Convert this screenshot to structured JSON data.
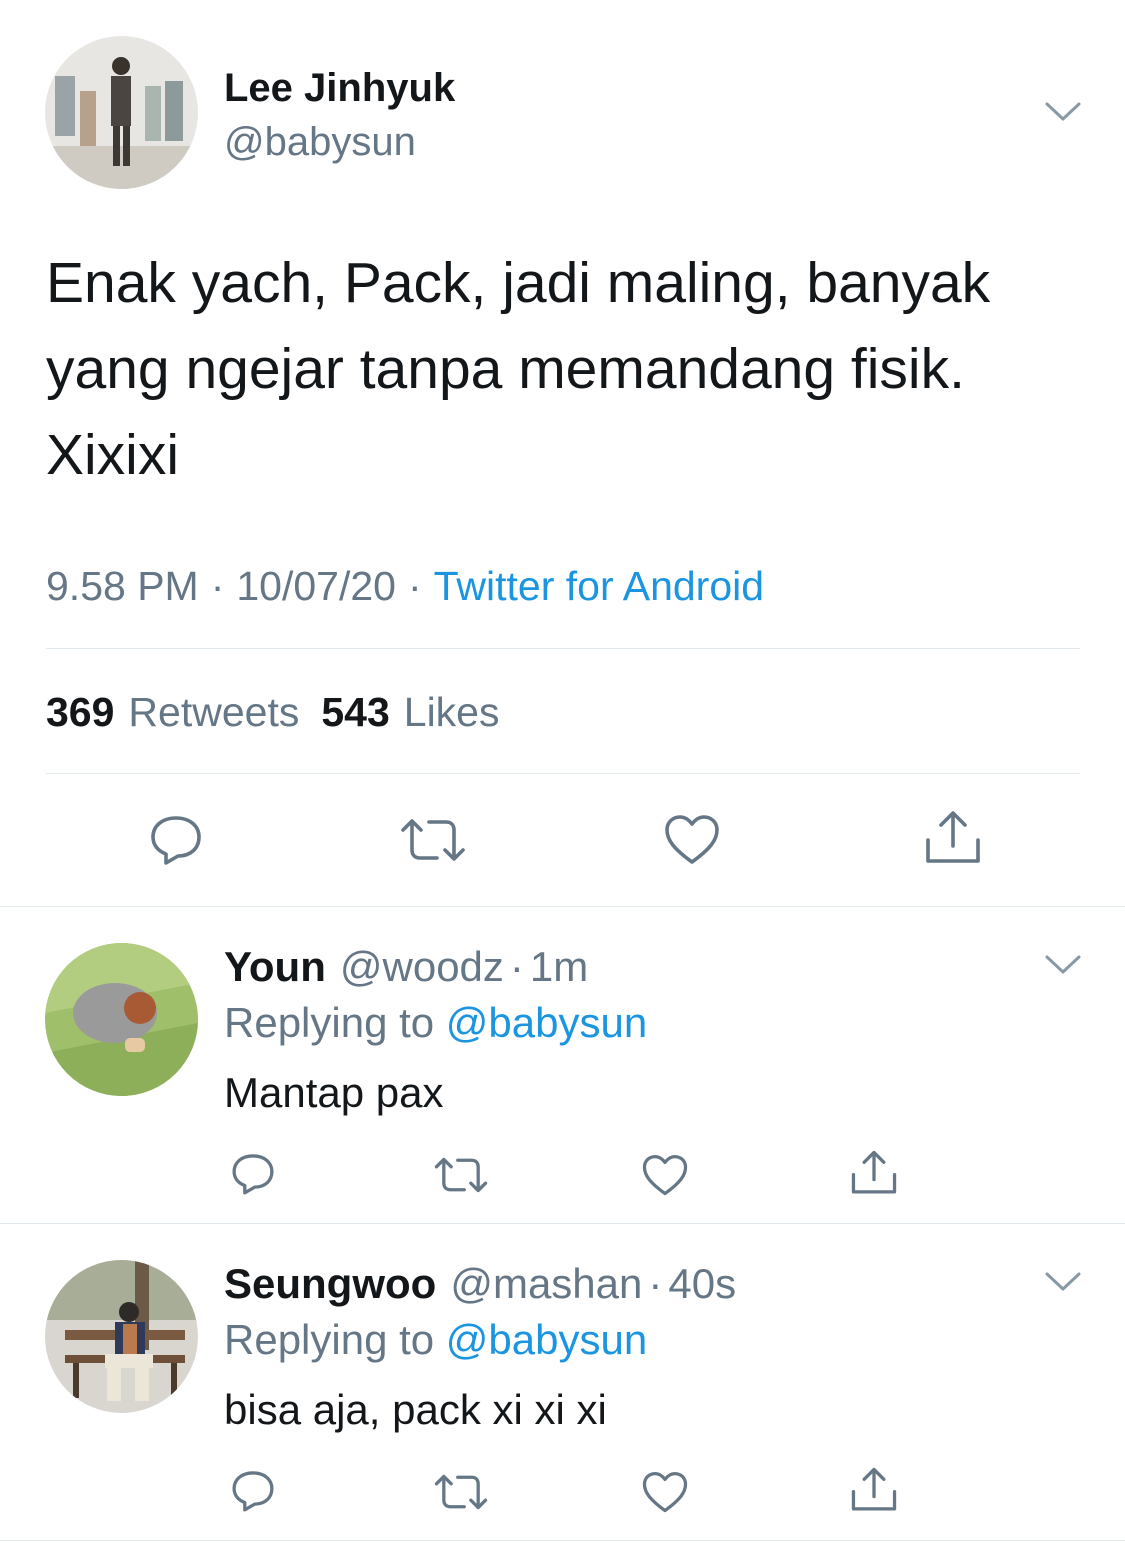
{
  "main_tweet": {
    "name": "Lee Jinhyuk",
    "handle": "@babysun",
    "text": "Enak yach, Pack, jadi maling, banyak\nyang ngejar tanpa memandang fisik.\nXixixi",
    "time": "9.58 PM",
    "date": "10/07/20",
    "source": "Twitter for Android",
    "separator": "·",
    "retweets_count": "369",
    "retweets_label": "Retweets",
    "likes_count": "543",
    "likes_label": "Likes"
  },
  "replies": [
    {
      "name": "Youn",
      "handle": "@woodz",
      "dot": "·",
      "time": "1m",
      "replying_prefix": "Replying to",
      "replying_handle": "@babysun",
      "text": "Mantap pax"
    },
    {
      "name": "Seungwoo",
      "handle": "@mashan",
      "dot": "·",
      "time": "40s",
      "replying_prefix": "Replying to",
      "replying_handle": "@babysun",
      "text": "bisa aja, pack xi xi xi"
    }
  ],
  "icons": {
    "reply": "reply-icon",
    "retweet": "retweet-icon",
    "like": "heart-icon",
    "share": "share-icon",
    "menu": "chevron-down-icon"
  },
  "colors": {
    "text": "#14171a",
    "muted": "#657786",
    "link": "#1b95e0",
    "divider": "#e1e8ed"
  }
}
